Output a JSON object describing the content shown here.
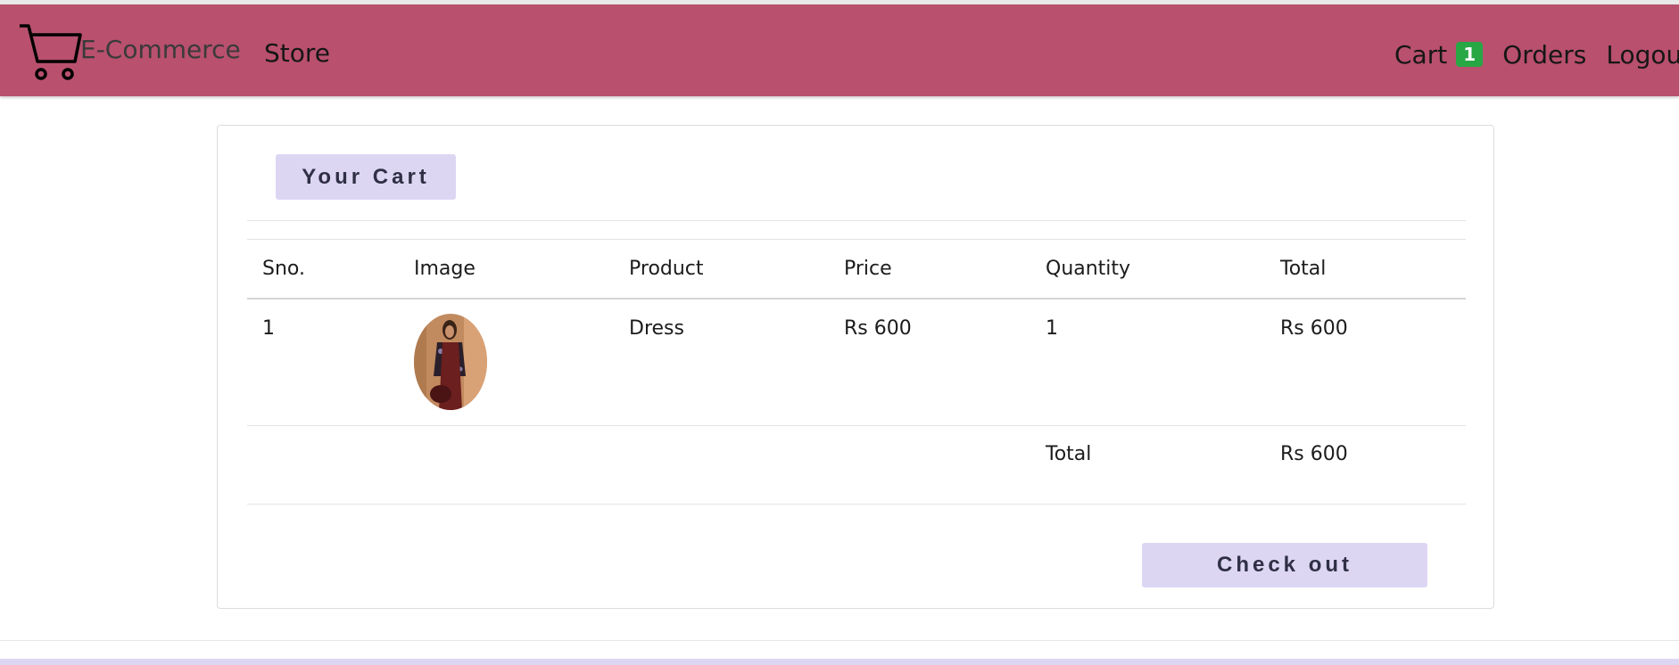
{
  "nav": {
    "brand": "E-Commerce",
    "store": "Store",
    "cart": "Cart",
    "cart_count": "1",
    "orders": "Orders",
    "logout": "Logout",
    "bar_color": "#b8506e",
    "badge_color": "#28a745",
    "logo_icon": "shopping-cart-icon"
  },
  "cart": {
    "title": "Your Cart",
    "columns": [
      "Sno.",
      "Image",
      "Product",
      "Price",
      "Quantity",
      "Total"
    ],
    "rows": [
      {
        "sno": "1",
        "image": "dress-product-image",
        "product": "Dress",
        "price": "Rs 600",
        "quantity": "1",
        "total": "Rs 600"
      }
    ],
    "total_label": "Total",
    "total_value": "Rs 600",
    "checkout_label": "Check out",
    "button_color": "#ddd6f3"
  }
}
